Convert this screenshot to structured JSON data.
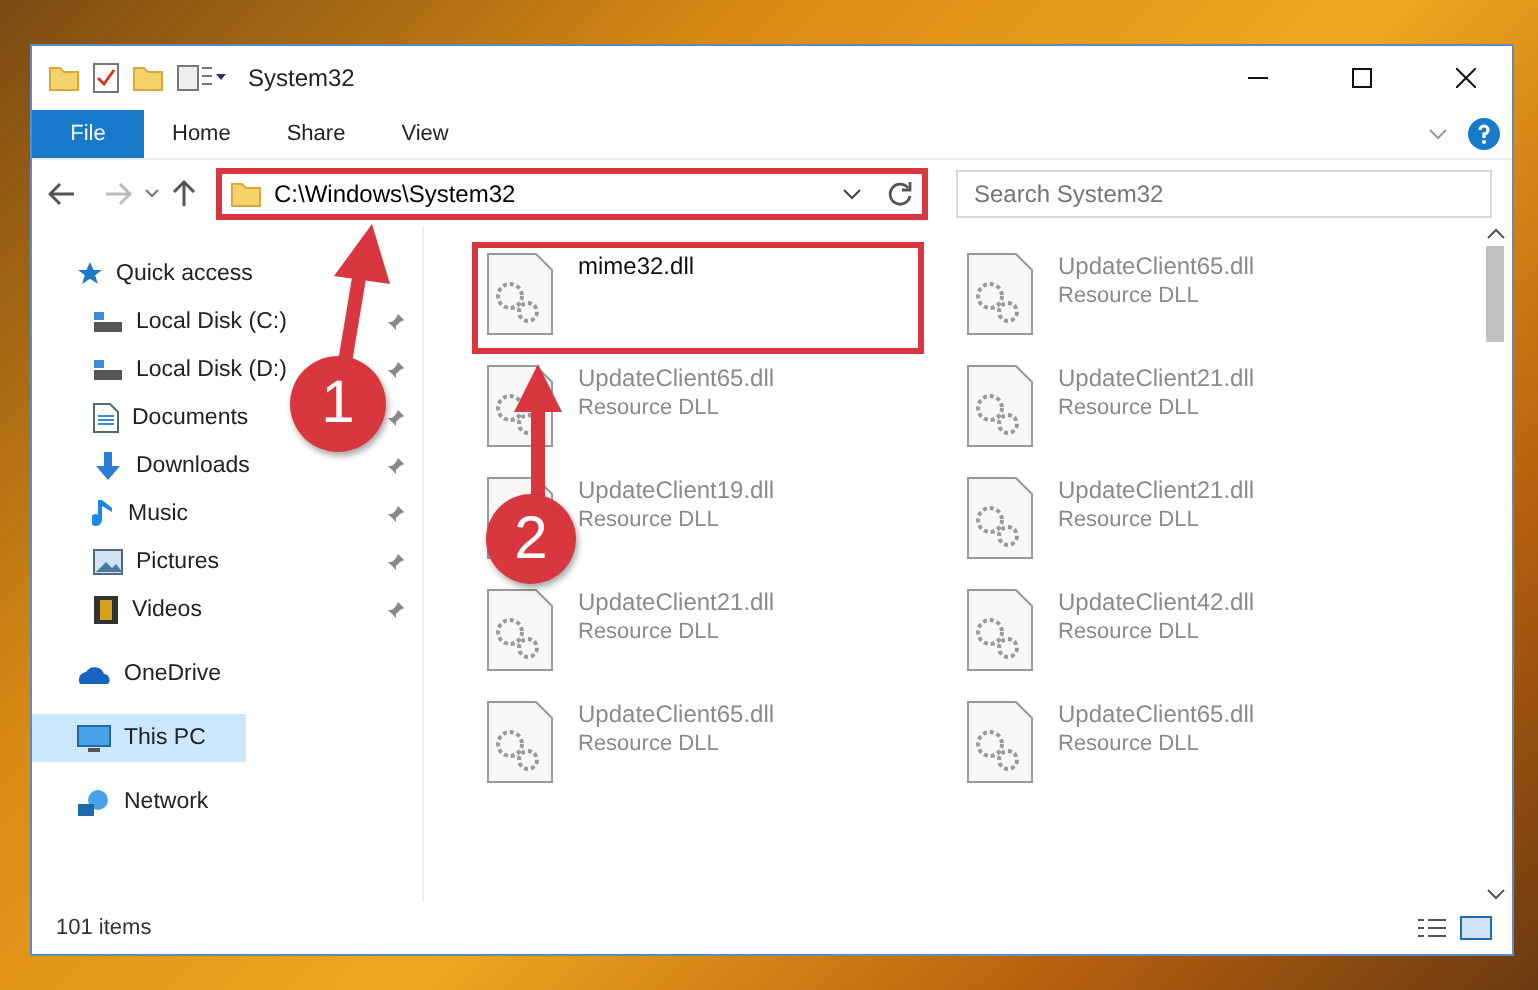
{
  "window": {
    "title": "System32"
  },
  "ribbon": {
    "tabs": [
      {
        "label": "File",
        "selected": true
      },
      {
        "label": "Home",
        "selected": false
      },
      {
        "label": "Share",
        "selected": false
      },
      {
        "label": "View",
        "selected": false
      }
    ]
  },
  "address": {
    "path": "C:\\Windows\\System32",
    "highlighted": true,
    "search_placeholder": "Search System32"
  },
  "sidebar": {
    "items": [
      {
        "label": "Quick access",
        "selected": false,
        "children": [
          {
            "label": "Local Disk (C:)",
            "pinned": true,
            "selected": false
          },
          {
            "label": "Local Disk (D:)",
            "pinned": true,
            "selected": false
          },
          {
            "label": "Documents",
            "pinned": true,
            "selected": false
          },
          {
            "label": "Downloads",
            "pinned": true,
            "selected": false
          },
          {
            "label": "Music",
            "pinned": true,
            "selected": false
          },
          {
            "label": "Pictures",
            "pinned": true,
            "selected": false
          },
          {
            "label": "Videos",
            "pinned": true,
            "selected": false
          }
        ]
      },
      {
        "label": "OneDrive",
        "selected": false
      },
      {
        "label": "This PC",
        "selected": true
      },
      {
        "label": "Network",
        "selected": false
      }
    ]
  },
  "files": [
    {
      "name": "mime32.dll",
      "highlighted": true,
      "faded": false
    },
    {
      "name": "UpdateClient65.dll",
      "type": "Resource DLL",
      "highlighted": false,
      "faded": true
    },
    {
      "name": "UpdateClient65.dll",
      "type": "Resource DLL",
      "highlighted": false,
      "faded": true
    },
    {
      "name": "UpdateClient21.dll",
      "type": "Resource DLL",
      "highlighted": false,
      "faded": true
    },
    {
      "name": "UpdateClient19.dll",
      "type": "Resource DLL",
      "highlighted": false,
      "faded": true
    },
    {
      "name": "UpdateClient21.dll",
      "type": "Resource DLL",
      "highlighted": false,
      "faded": true
    },
    {
      "name": "UpdateClient21.dll",
      "type": "Resource DLL",
      "highlighted": false,
      "faded": true
    },
    {
      "name": "UpdateClient42.dll",
      "type": "Resource DLL",
      "highlighted": false,
      "faded": true
    },
    {
      "name": "UpdateClient65.dll",
      "type": "Resource DLL",
      "highlighted": false,
      "faded": true
    },
    {
      "name": "UpdateClient65.dll",
      "type": "Resource DLL",
      "highlighted": false,
      "faded": true
    }
  ],
  "status_bar": {
    "count": "101 items"
  },
  "annotations": [
    {
      "number": "1"
    },
    {
      "number": "2"
    }
  ]
}
